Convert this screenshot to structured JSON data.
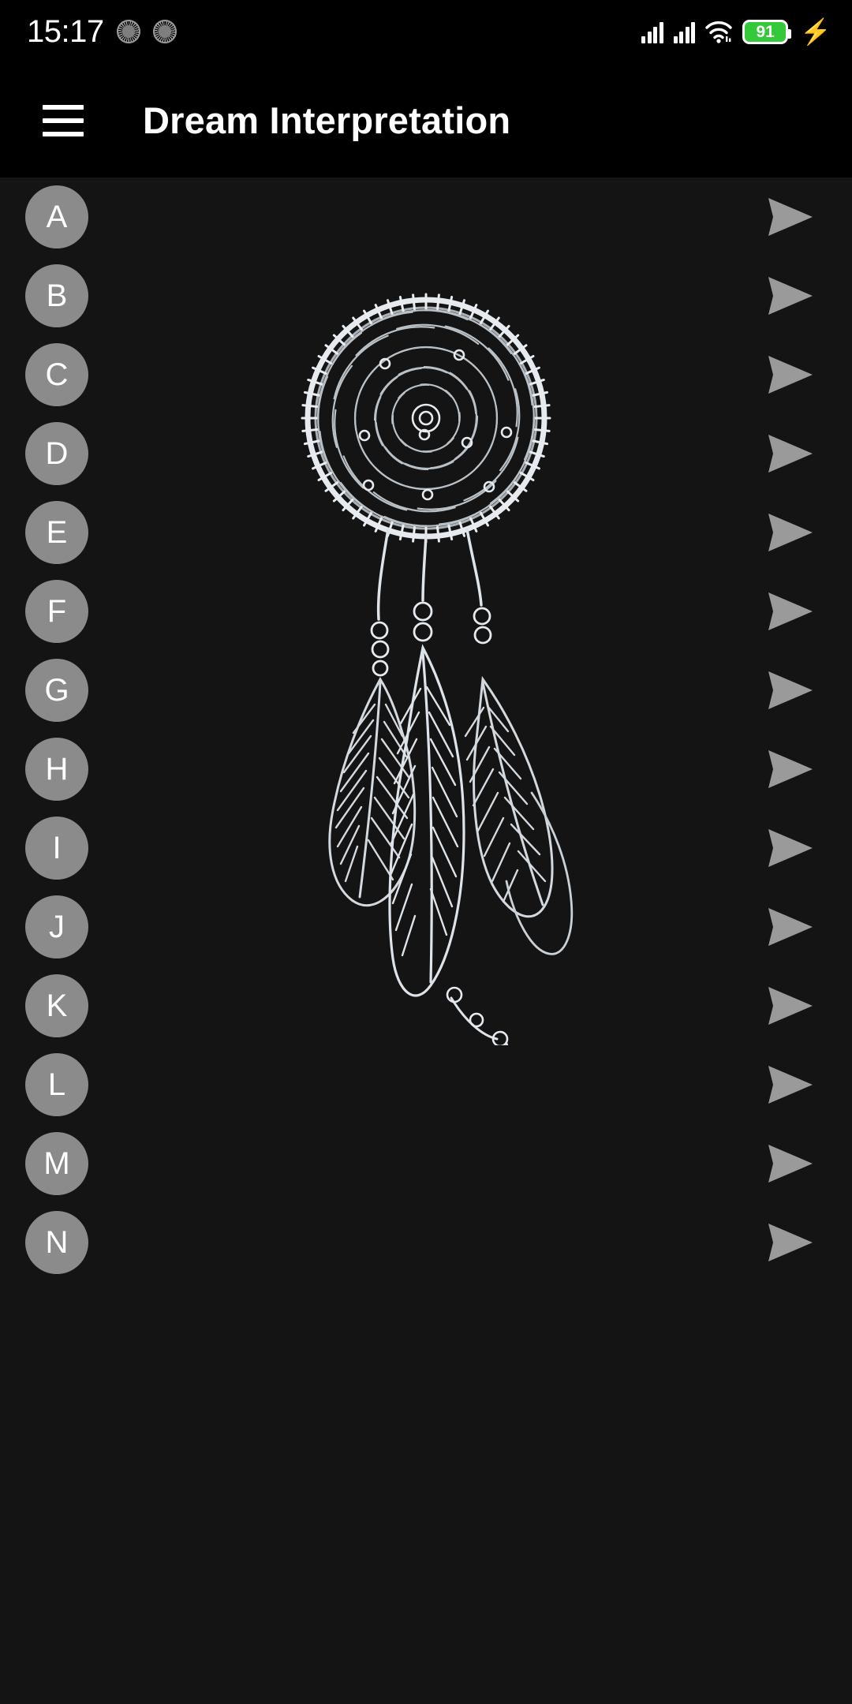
{
  "status_bar": {
    "time": "15:17",
    "sync_icons": [
      "sync-circle-icon",
      "sync-circle-icon"
    ],
    "signal_icons": [
      "signal-bars-icon",
      "signal-bars-icon"
    ],
    "wifi_icon": "wifi-icon",
    "battery_level": "91",
    "battery_color": "#34c93b",
    "charging_icon": "charging-bolt-icon"
  },
  "app_bar": {
    "menu_icon": "hamburger-menu-icon",
    "title": "Dream Interpretation"
  },
  "content": {
    "background_art": "dreamcatcher-illustration",
    "background_color": "#141414",
    "avatar_color": "#8b8b8b",
    "arrow_color": "#9a9a9a",
    "arrow_icon": "send-arrow-icon",
    "letters": [
      {
        "label": "A"
      },
      {
        "label": "B"
      },
      {
        "label": "C"
      },
      {
        "label": "D"
      },
      {
        "label": "E"
      },
      {
        "label": "F"
      },
      {
        "label": "G"
      },
      {
        "label": "H"
      },
      {
        "label": "I"
      },
      {
        "label": "J"
      },
      {
        "label": "K"
      },
      {
        "label": "L"
      },
      {
        "label": "M"
      },
      {
        "label": "N"
      }
    ]
  }
}
